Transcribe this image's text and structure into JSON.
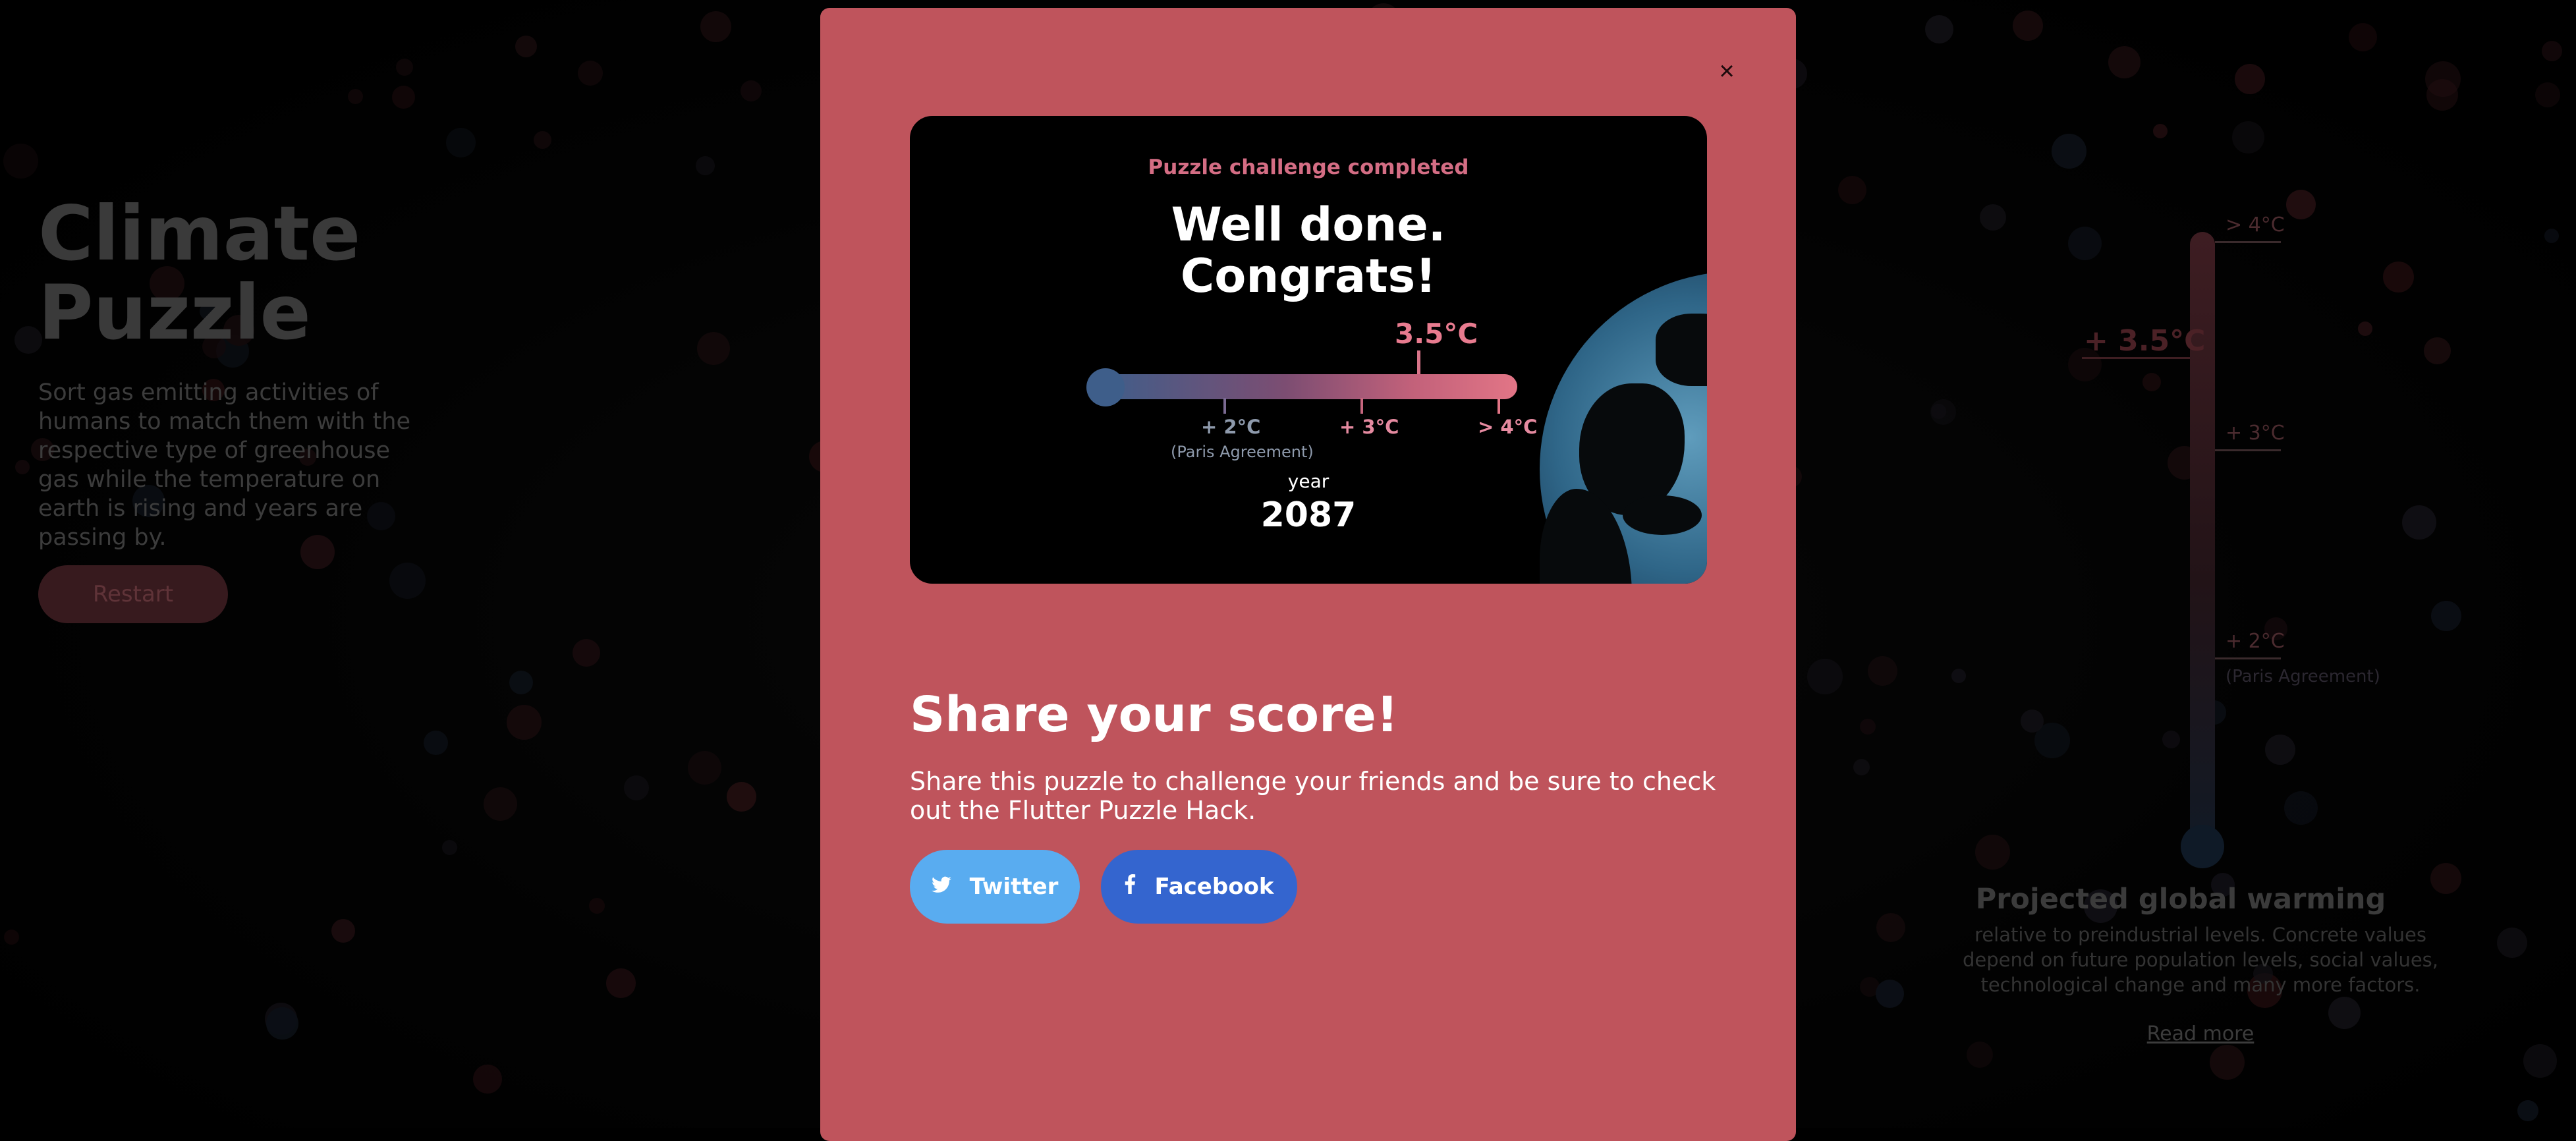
{
  "app": {
    "title": "Climate\nPuzzle",
    "description": "Sort gas emitting activities of humans to match them with the respective type of greenhouse gas while the temperature on earth is rising and years are passing by.",
    "restart_label": "Restart"
  },
  "sidebar_thermometer": {
    "labels": [
      "> 4°C",
      "+ 3°C",
      "+ 2°C"
    ],
    "paris_label": "(Paris Agreement)",
    "current_mark": "+ 3.5°C",
    "heading": "Projected global warming",
    "description": "relative to preindustrial levels. Concrete values depend on future population levels, social values, technological change and many more factors.",
    "read_more": "Read more"
  },
  "modal": {
    "close_label": "×",
    "card": {
      "subtitle": "Puzzle challenge completed",
      "headline_line1": "Well done.",
      "headline_line2": "Congrats!",
      "temperature": "3.5°C",
      "temperature_fraction": 0.82,
      "ticks": [
        "+ 2°C",
        "+ 3°C",
        "> 4°C"
      ],
      "tick_sub": "(Paris Agreement)",
      "year_label": "year",
      "year_value": "2087"
    },
    "share": {
      "title": "Share your score!",
      "text": "Share this puzzle to challenge your friends and be sure to check out the Flutter Puzzle Hack.",
      "twitter_label": "Twitter",
      "facebook_label": "Facebook",
      "twitter_icon": "twitter-icon",
      "facebook_icon": "facebook-icon"
    }
  },
  "colors": {
    "modal_bg": "#bf545c",
    "twitter": "#59acf0",
    "facebook": "#3465cf",
    "accent_pink": "#d46d84"
  }
}
